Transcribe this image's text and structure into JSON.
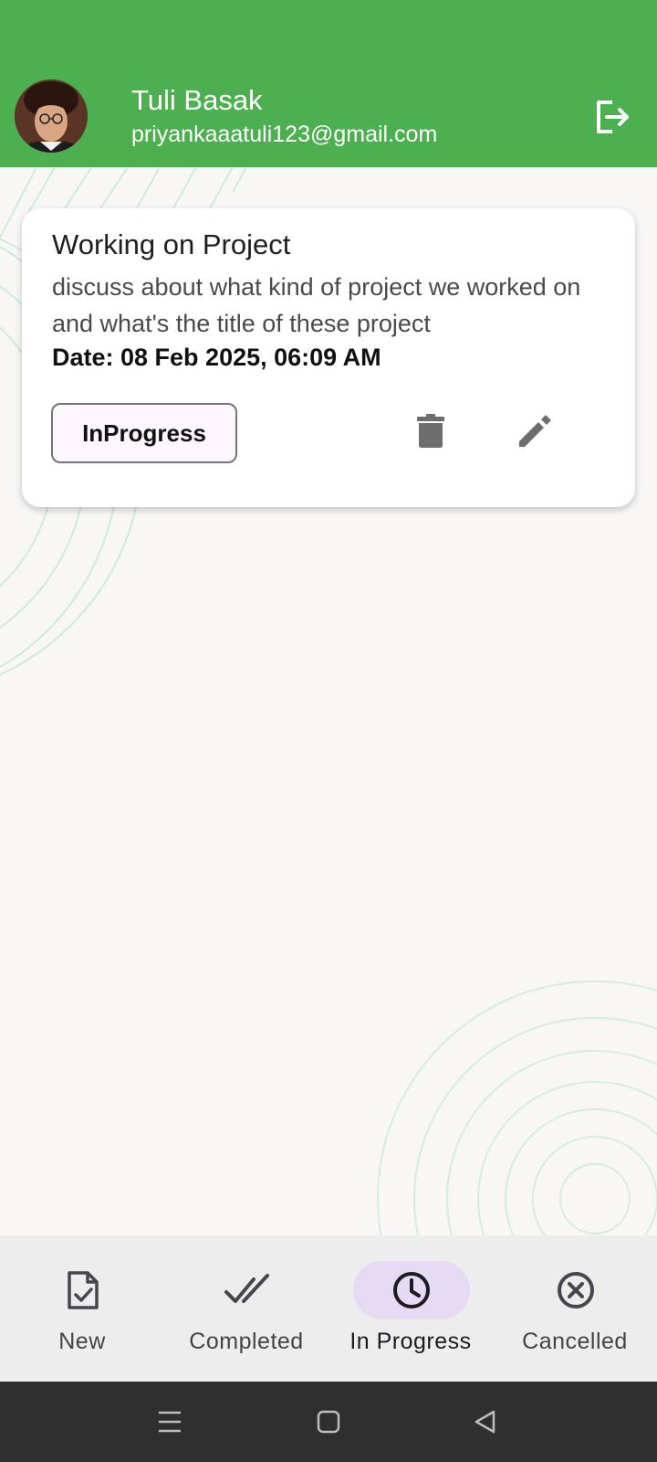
{
  "user": {
    "name": "Tuli Basak",
    "email": "priyankaaatuli123@gmail.com"
  },
  "colors": {
    "header": "#4caf50",
    "card": "#ffffff",
    "active_nav_pill": "#e6daf4",
    "icon": "#6d6d6d"
  },
  "tasks": [
    {
      "title": "Working on Project",
      "description": "discuss about what kind of project we worked on and what's the title of these project",
      "date": "Date: 08 Feb 2025, 06:09 AM",
      "status": "InProgress",
      "actions": [
        "delete-icon",
        "edit-icon"
      ]
    }
  ],
  "bottom_nav": {
    "active": "In Progress",
    "items": [
      {
        "label": "New",
        "icon": "new-task-icon"
      },
      {
        "label": "Completed",
        "icon": "double-check-icon"
      },
      {
        "label": "In Progress",
        "icon": "clock-icon"
      },
      {
        "label": "Cancelled",
        "icon": "cancel-circle-icon"
      }
    ]
  },
  "system_nav": {
    "icons": [
      "menu-icon",
      "home-icon",
      "back-icon"
    ]
  }
}
